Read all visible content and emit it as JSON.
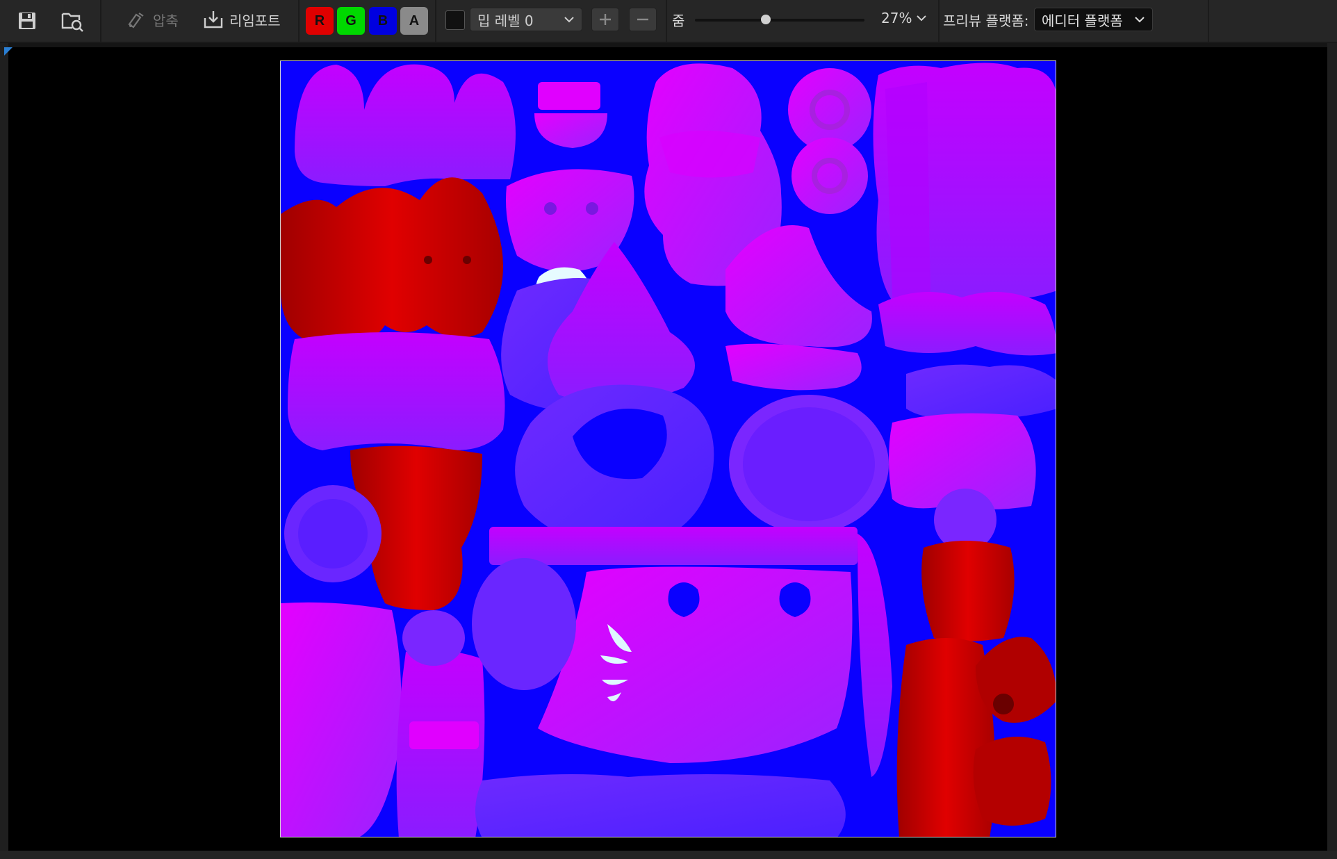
{
  "toolbar": {
    "save_icon": "save-icon",
    "browse_icon": "browse-asset-icon",
    "compress_label": "압축",
    "reimport_label": "리임포트",
    "channels": [
      {
        "label": "R",
        "color": "#e00000"
      },
      {
        "label": "G",
        "color": "#00d800"
      },
      {
        "label": "B",
        "color": "#0000e0"
      },
      {
        "label": "A",
        "color": "#8a8a8a"
      }
    ],
    "mip_level_value": "밉 레벨 0",
    "mip_plus": "+",
    "mip_minus": "−",
    "zoom_label": "줌",
    "zoom_level": 0.27,
    "zoom_value": "27%",
    "preview_platform_label": "프리뷰 플랫폼:",
    "preview_platform_value": "에디터 플랫폼"
  },
  "colors": {
    "background_blue": "#0a00ff",
    "violet": "#9a1bff",
    "magenta": "#d600ff",
    "red": "#d40000",
    "highlight": "#dff9ff"
  }
}
